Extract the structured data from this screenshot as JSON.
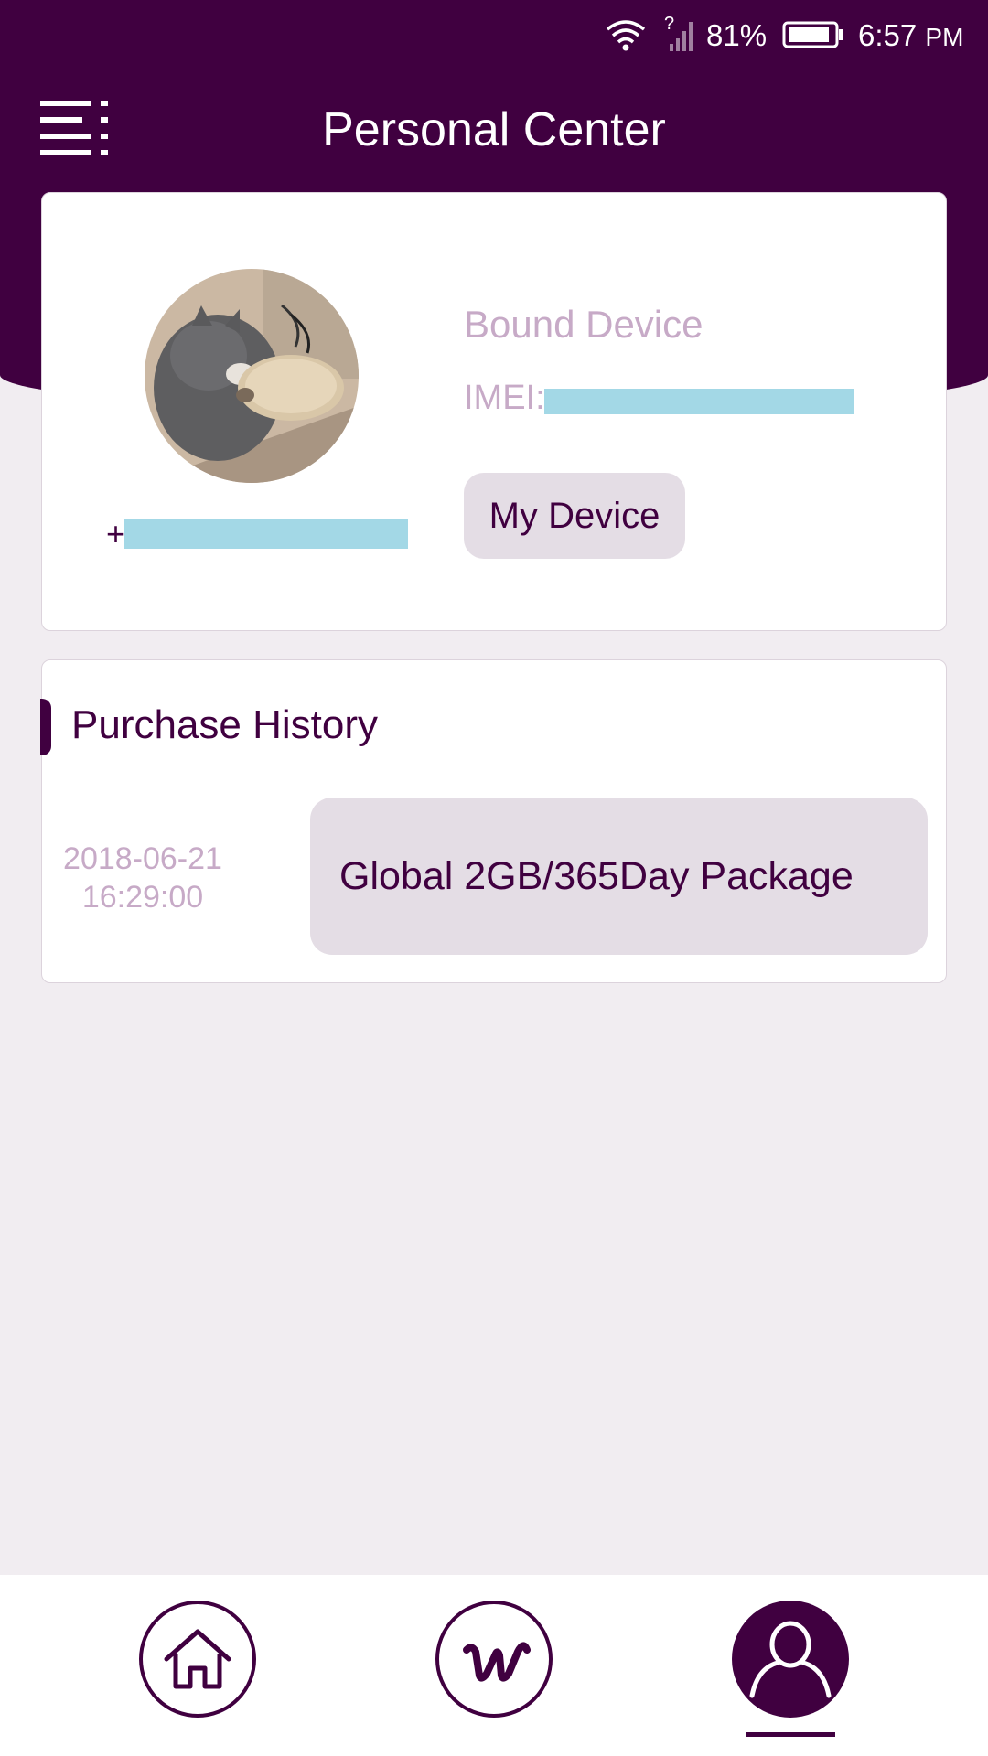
{
  "status_bar": {
    "battery_percent": "81%",
    "time": "6:57",
    "ampm": "PM"
  },
  "header": {
    "title": "Personal Center"
  },
  "profile": {
    "phone_prefix": "+",
    "bound_device_label": "Bound Device",
    "imei_label": "IMEI:",
    "my_device_button": "My Device"
  },
  "purchase_history": {
    "title": "Purchase History",
    "items": [
      {
        "date": "2018-06-21",
        "time": "16:29:00",
        "package": "Global 2GB/365Day Package"
      }
    ]
  },
  "bottom_nav": {
    "items": [
      {
        "icon": "home-icon",
        "active": false
      },
      {
        "icon": "brand-w-icon",
        "active": false
      },
      {
        "icon": "user-icon",
        "active": true
      }
    ]
  },
  "colors": {
    "primary": "#400040",
    "muted_text": "#c7aac7",
    "button_bg": "#e4dde5",
    "page_bg": "#f1edf1",
    "redaction": "#a3d8e6"
  }
}
